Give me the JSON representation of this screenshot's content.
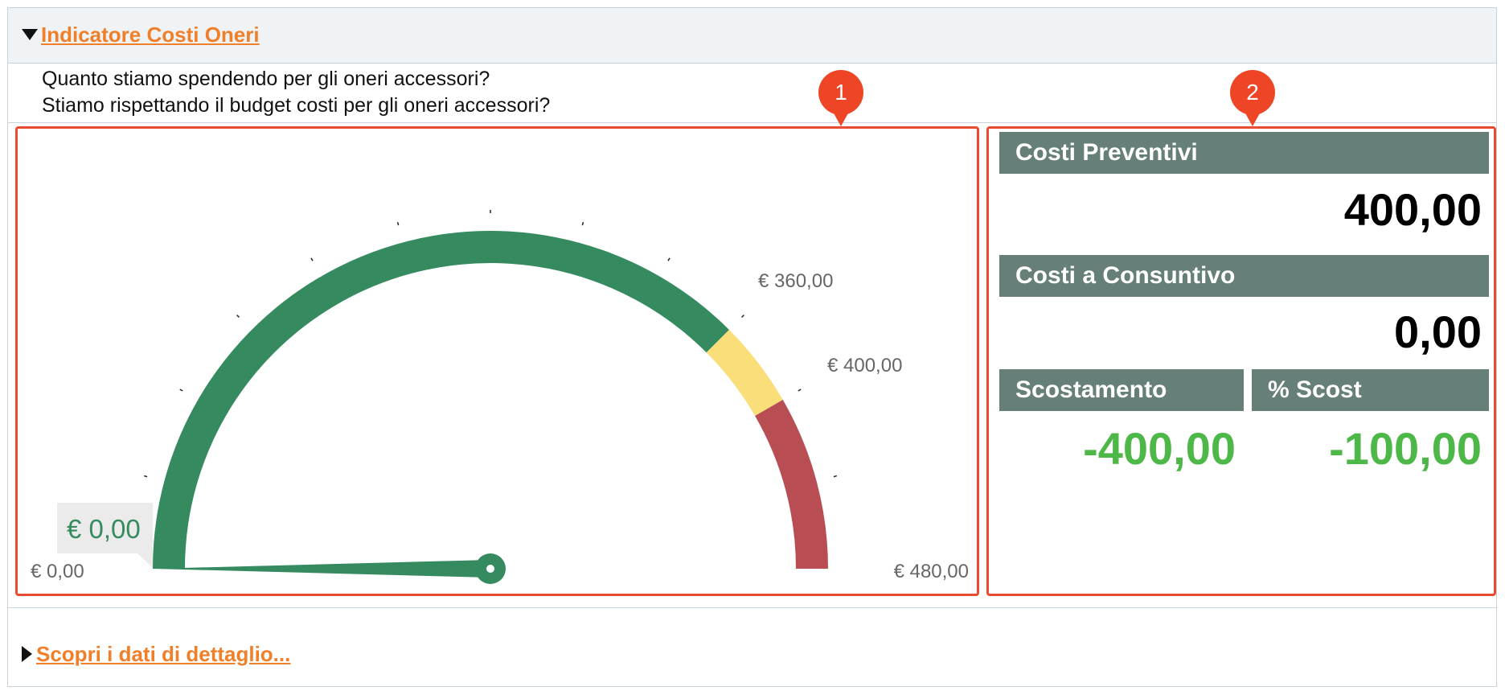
{
  "header": {
    "title": "Indicatore Costi Oneri"
  },
  "questions": [
    "Quanto stiamo spendendo per gli oneri accessori?",
    "Stiamo rispettando il budget costi per gli oneri accessori?"
  ],
  "markers": [
    "1",
    "2"
  ],
  "gauge": {
    "current_value_label": "€ 0,00",
    "value": 0,
    "min": 0,
    "max": 480,
    "min_label": "€ 0,00",
    "max_label": "€ 480,00",
    "threshold_labels": [
      "€ 360,00",
      "€ 400,00"
    ],
    "bands": [
      {
        "from": 0,
        "to": 360,
        "color": "#358b5f"
      },
      {
        "from": 360,
        "to": 400,
        "color": "#f9de7a"
      },
      {
        "from": 400,
        "to": 480,
        "color": "#b84e53"
      }
    ],
    "needle_color": "#358b5f"
  },
  "metrics": {
    "costi_preventivi_label": "Costi Preventivi",
    "costi_preventivi_value": "400,00",
    "costi_consuntivo_label": "Costi a Consuntivo",
    "costi_consuntivo_value": "0,00",
    "scostamento_label": "Scostamento",
    "scostamento_value": "-400,00",
    "perc_scost_label": "% Scost",
    "perc_scost_value": "-100,00"
  },
  "footer": {
    "detail_link": "Scopri i dati di dettaglio..."
  },
  "colors": {
    "accent_orange": "#f07f2a",
    "highlight_red": "#e94b30",
    "metric_header_bg": "#677f79",
    "positive_green": "#4db848"
  }
}
